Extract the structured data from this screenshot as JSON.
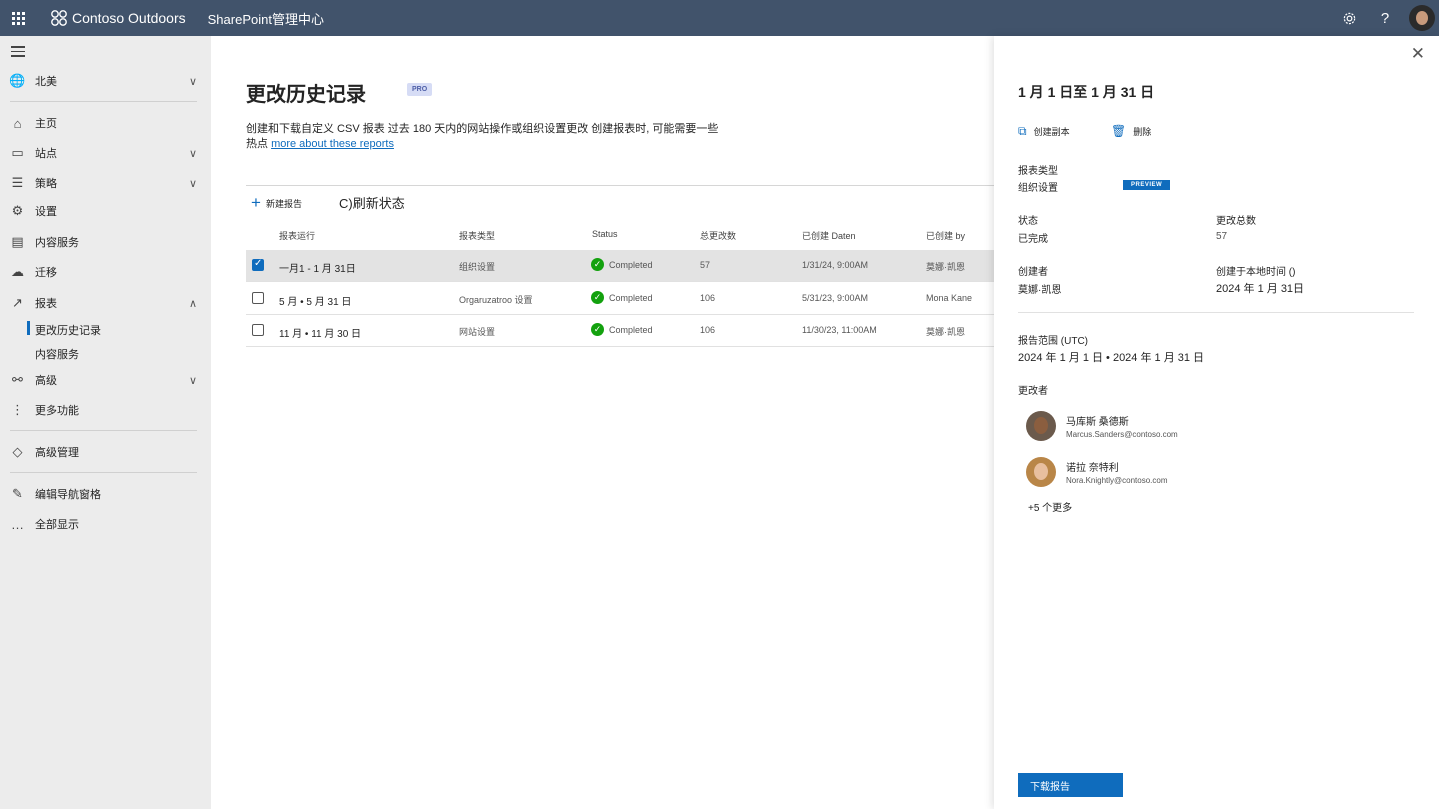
{
  "topbar": {
    "brand": "Contoso Outdoors",
    "app_name": "SharePoint管理中心"
  },
  "nav": {
    "region": "北美",
    "items": [
      {
        "label": "主页",
        "icon": "home-icon"
      },
      {
        "label": "站点",
        "icon": "site-icon"
      },
      {
        "label": "策略",
        "icon": "policy-icon"
      },
      {
        "label": "设置",
        "icon": "gear-icon"
      },
      {
        "label": "内容服务",
        "icon": "content-icon"
      },
      {
        "label": "迁移",
        "icon": "cloud-upload-icon"
      },
      {
        "label": "报表",
        "icon": "chart-icon"
      }
    ],
    "sub_items": [
      "更改历史记录",
      "内容服务"
    ],
    "advanced": "高级",
    "more_features": "更多功能",
    "advanced_management": "高级管理",
    "edit_nav": "编辑导航窗格",
    "show_all": "全部显示"
  },
  "main": {
    "title": "更改历史记录",
    "pro_badge": "PRO",
    "description": "创建和下载自定义 CSV 报表 过去 180 天内的网站操作或组织设置更改 创建报表时, 可能需要一些",
    "description_line2": "热点",
    "link": "more about these reports",
    "new_report": "新建报告",
    "refresh": "C)刷新状态",
    "columns": {
      "run": "报表运行",
      "type": "报表类型",
      "status": "Status",
      "total": "总更改数",
      "created_date": "已创建 Daten",
      "created_by": "已创建 by"
    },
    "rows": [
      {
        "range": "一月1 - 1 月 31日",
        "type": "组织设置",
        "status": "Completed",
        "total": "57",
        "created": "1/31/24, 9:00AM",
        "by": "莫娜·凯恩"
      },
      {
        "range": "5 月 • 5 月 31 日",
        "type": "Orgaruzatroo 设置",
        "status": "Completed",
        "total": "106",
        "created": "5/31/23, 9:00AM",
        "by": "Mona Kane"
      },
      {
        "range": "11 月 • 11 月 30 日",
        "type": "网站设置",
        "status": "Completed",
        "total": "106",
        "created": "11/30/23, 11:00AM",
        "by": "莫娜·凯恩"
      }
    ]
  },
  "panel": {
    "title": "1 月 1 日至 1 月 31 日",
    "copy": "创建副本",
    "delete": "删除",
    "report_type_label": "报表类型",
    "report_type_value": "组织设置",
    "preview": "PREVIEW",
    "state_label": "状态",
    "state_value": "已完成",
    "total_label": "更改总数",
    "total_value": "57",
    "creator_label": "创建者",
    "creator_value": "莫娜·凯恩",
    "created_local_label": "创建于本地时间 ()",
    "created_local_value": "2024 年 1 月 31日",
    "range_label": "报告范围 (UTC)",
    "range_value": "2024 年 1 月 1 日 • 2024 年 1 月 31 日",
    "changers_label": "更改者",
    "people": [
      {
        "name": "马库斯 桑德斯",
        "email": "Marcus.Sanders@contoso.com"
      },
      {
        "name": "诺拉 奈特利",
        "email": "Nora.Knightly@contoso.com"
      }
    ],
    "more": "+5 个更多",
    "download": "下载报告"
  }
}
